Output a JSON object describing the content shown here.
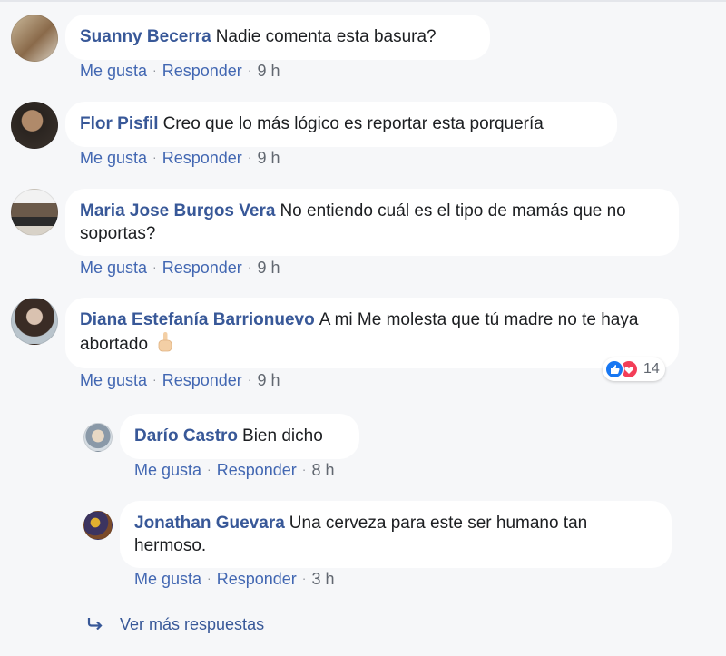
{
  "colors": {
    "link": "#385898",
    "action": "#4267b2",
    "bubble": "#ffffff",
    "background": "#f6f7f9",
    "like": "#1877f2",
    "love": "#f33e58"
  },
  "actions": {
    "like": "Me gusta",
    "reply": "Responder",
    "separator": "·"
  },
  "comments": [
    {
      "author": "Suanny Becerra",
      "text": "Nadie comenta esta basura?",
      "time": "9 h"
    },
    {
      "author": "Flor Pisfil",
      "text": "Creo que lo más lógico es reportar esta porquería",
      "time": "9 h"
    },
    {
      "author": "Maria Jose Burgos Vera",
      "text": "No entiendo cuál es el tipo de mamás que no soportas?",
      "time": "9 h"
    },
    {
      "author": "Diana Estefanía Barrionuevo",
      "text": "A mi Me molesta que tú madre no te haya abortado",
      "emoji": "middle-finger-emoji",
      "time": "9 h",
      "reactions": {
        "count": "14",
        "icons": [
          "like-icon",
          "love-icon"
        ]
      }
    }
  ],
  "replies": [
    {
      "author": "Darío Castro",
      "text": "Bien dicho",
      "time": "8 h"
    },
    {
      "author": "Jonathan Guevara",
      "text": "Una cerveza para este ser humano tan hermoso.",
      "time": "3 h"
    }
  ],
  "more_replies": {
    "icon": "reply-arrow-icon",
    "label": "Ver más respuestas"
  }
}
